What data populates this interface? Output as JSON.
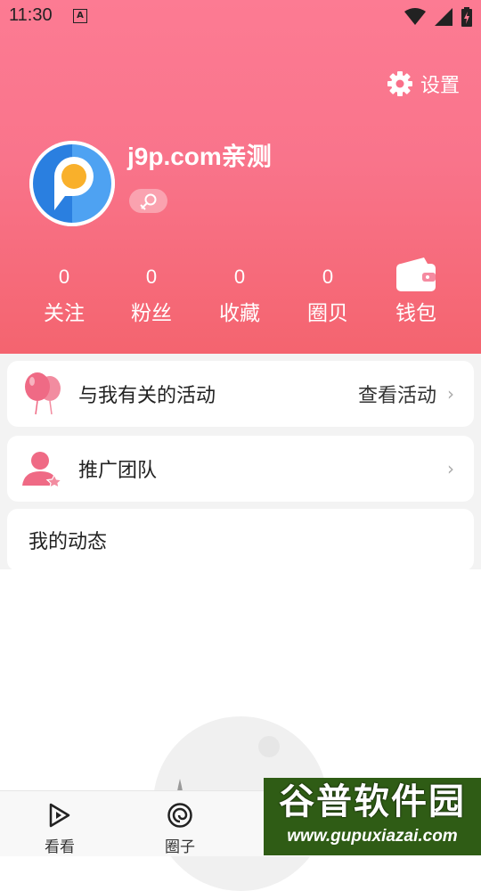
{
  "status_bar": {
    "time": "11:30",
    "notification_letter": "A"
  },
  "header": {
    "settings_label": "设置",
    "username": "j9p.com亲测",
    "stats": [
      {
        "value": "0",
        "label": "关注"
      },
      {
        "value": "0",
        "label": "粉丝"
      },
      {
        "value": "0",
        "label": "收藏"
      },
      {
        "value": "0",
        "label": "圈贝"
      }
    ],
    "wallet_label": "钱包"
  },
  "menu": {
    "activities": {
      "title": "与我有关的活动",
      "action": "查看活动"
    },
    "team": {
      "title": "推广团队"
    },
    "dynamics_title": "我的动态"
  },
  "tabbar": {
    "tabs": [
      {
        "label": "看看",
        "icon": "play-icon"
      },
      {
        "label": "圈子",
        "icon": "circle-icon"
      }
    ]
  },
  "watermark": {
    "title": "谷普软件园",
    "url": "www.gupuxiazai.com"
  },
  "colors": {
    "header_top": "#fc7b93",
    "header_bottom": "#f4646f",
    "accent_pink": "#f0607a"
  }
}
